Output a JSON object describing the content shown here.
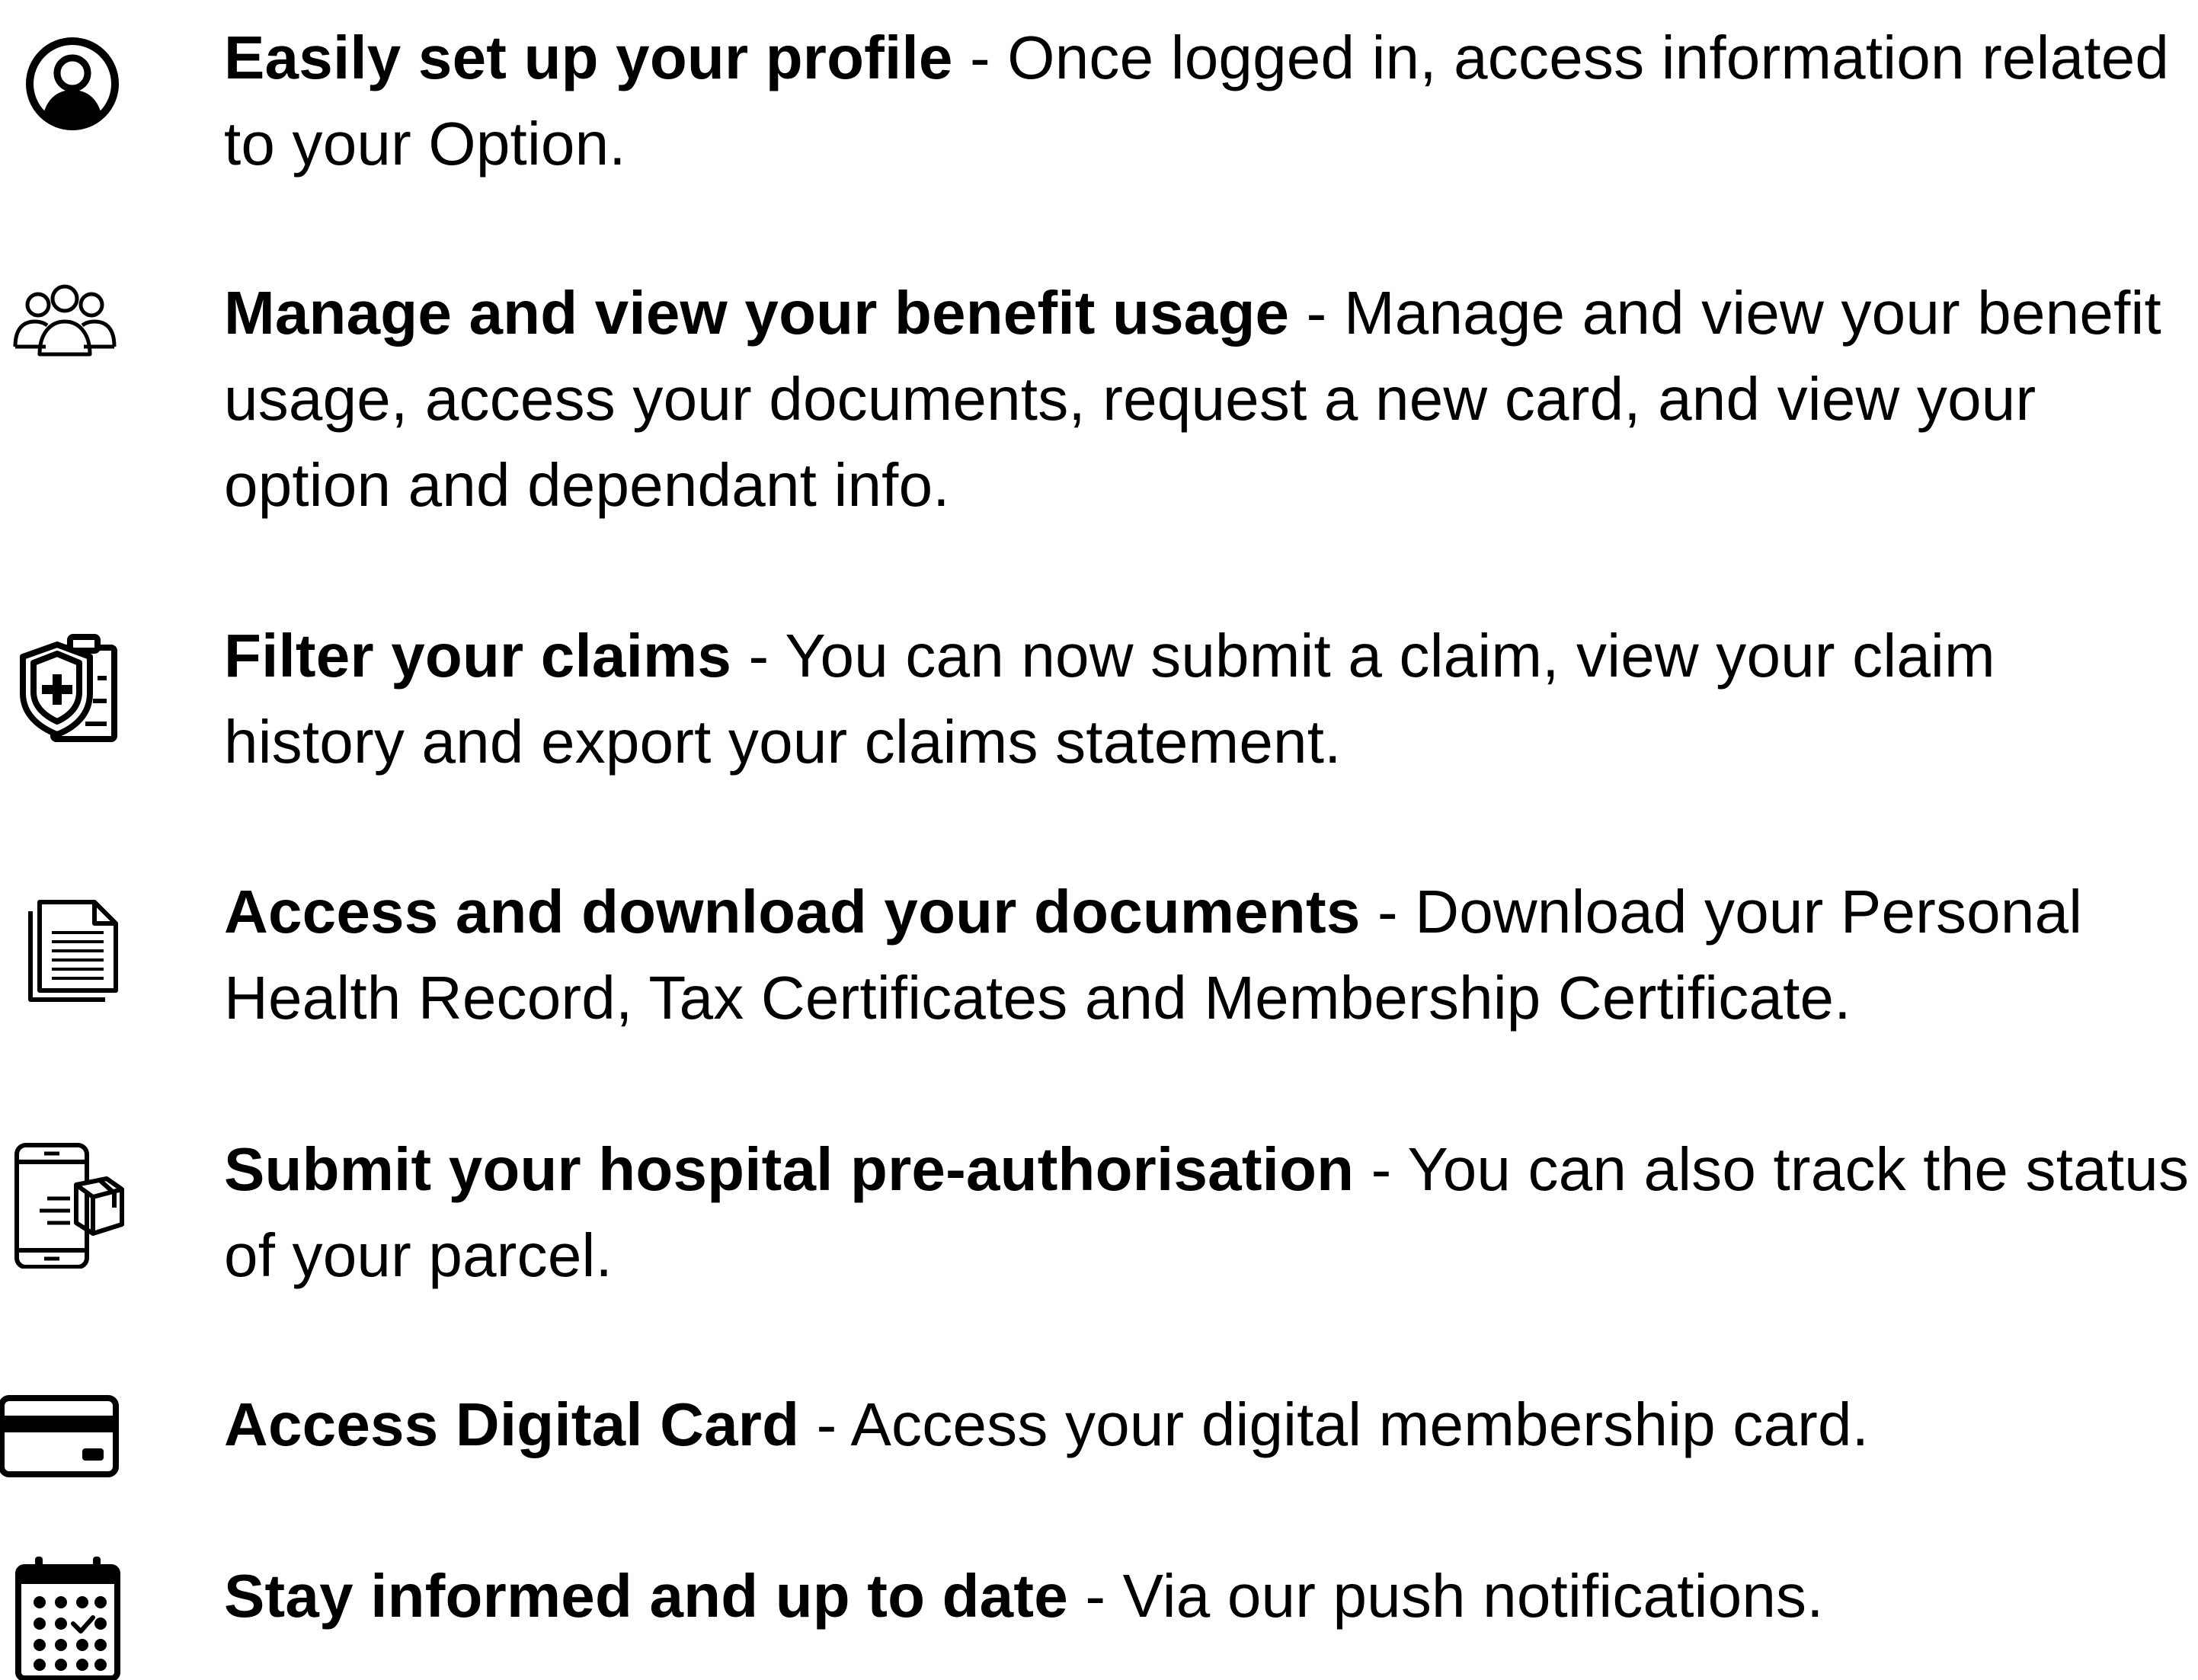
{
  "features": [
    {
      "icon": "user-profile-icon",
      "title": "Easily set up your profile",
      "separator": " - ",
      "description": "Once logged in, access information related to your Option."
    },
    {
      "icon": "people-group-icon",
      "title": "Manage and view your benefit usage",
      "separator": " - ",
      "description": "Manage and view your benefit usage, access your documents, request a new card, and view your option and dependant info."
    },
    {
      "icon": "shield-clipboard-icon",
      "title": "Filter your claims",
      "separator": " - ",
      "description": "You can now submit a claim, view your claim history and export your claims statement."
    },
    {
      "icon": "document-stack-icon",
      "title": "Access and download your documents",
      "separator": " - ",
      "description": "Download your Personal Health Record, Tax Certificates and Membership Certificate."
    },
    {
      "icon": "phone-parcel-icon",
      "title": "Submit your hospital pre-authorisation",
      "separator": " - ",
      "description": "You can also track the status of your parcel."
    },
    {
      "icon": "credit-card-icon",
      "title": "Access Digital Card",
      "separator": " - ",
      "description": "Access your digital membership card."
    },
    {
      "icon": "calendar-check-icon",
      "title": "Stay informed and up to date",
      "separator": " - ",
      "description": "Via our push notifications."
    }
  ]
}
